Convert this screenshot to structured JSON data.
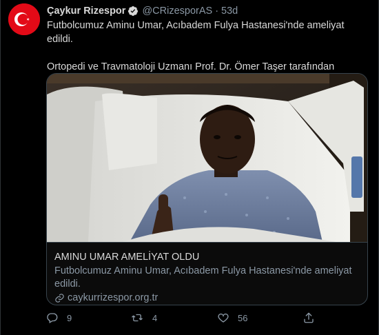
{
  "tweet": {
    "author_name": "Çaykur Rizespor",
    "handle": "@CRizesporAS",
    "separator": "·",
    "time": "53d",
    "paragraphs": [
      "Futbolcumuz Aminu Umar, Acıbadem Fulya Hastanesi'nde ameliyat edildi.",
      "Ortopedi ve Travmatoloji Uzmanı Prof. Dr. Ömer Taşer tarafından sporcuya ön çapraz bağ rekonstrüksiyonu yapıldı."
    ]
  },
  "card": {
    "title": "AMINU UMAR AMELİYAT OLDU",
    "description": "Futbolcumuz Aminu Umar, Acıbadem Fulya Hastanesi'nde ameliyat edildi.",
    "link": "caykurrizespor.org.tr"
  },
  "actions": {
    "reply_count": "9",
    "retweet_count": "4",
    "like_count": "56"
  },
  "colors": {
    "background": "#000000",
    "text": "#d9d9d9",
    "muted": "#8b98a5",
    "border": "#38444d",
    "avatar_red": "#e30a17",
    "verified_blue": "#1d9bf0"
  },
  "icons": [
    "turkish-flag-logo",
    "verified-badge-icon",
    "link-icon",
    "reply-icon",
    "retweet-icon",
    "like-icon",
    "share-icon"
  ]
}
